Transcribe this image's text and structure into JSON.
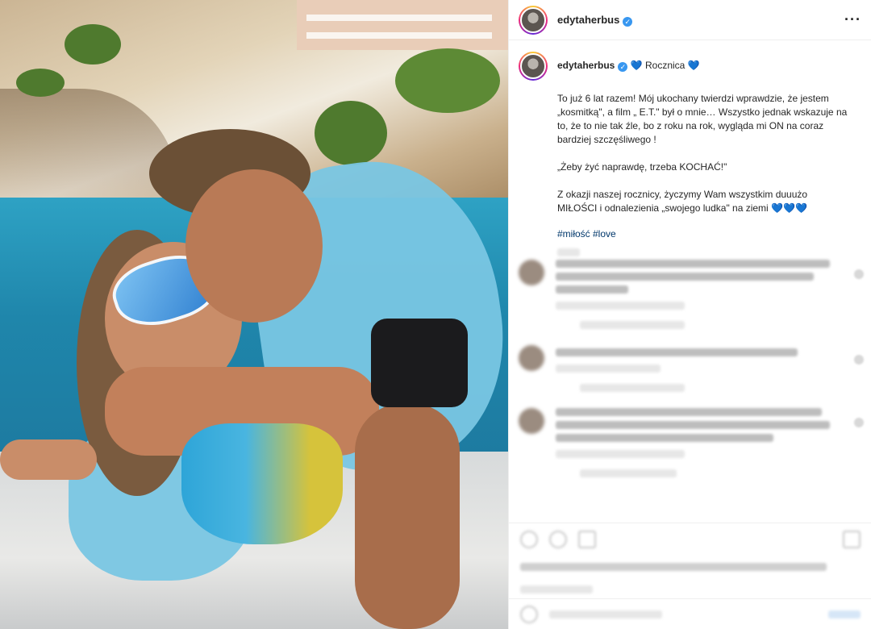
{
  "post": {
    "username": "edytaherbus",
    "verified_icon": "verified-badge-icon",
    "more_icon": "more-options-icon",
    "more_label": "···"
  },
  "caption": {
    "username": "edytaherbus",
    "title_heart_left": "💙",
    "title": "Rocznica",
    "title_heart_right": "💙",
    "paragraph1": "To już 6 lat razem! Mój ukochany twierdzi wprawdzie, że jestem „kosmitką\", a film „ E.T.\" był o mnie… Wszystko jednak wskazuje na to, że to nie tak źle, bo z roku na rok, wygląda mi ON na coraz bardziej szczęśliwego !",
    "paragraph2": "„Żeby żyć naprawdę, trzeba KOCHAĆ!\"",
    "paragraph3": "Z okazji naszej rocznicy, życzymy Wam wszystkim duuużo MIŁOŚCI i odnalezienia „swojego ludka\" na ziemi",
    "paragraph3_hearts": "💙💙💙",
    "hashtags": "#miłość #love"
  },
  "colors": {
    "accent_blue": "#3897f0",
    "heart_blue": "#1d6fd8",
    "hashtag": "#00376b"
  }
}
